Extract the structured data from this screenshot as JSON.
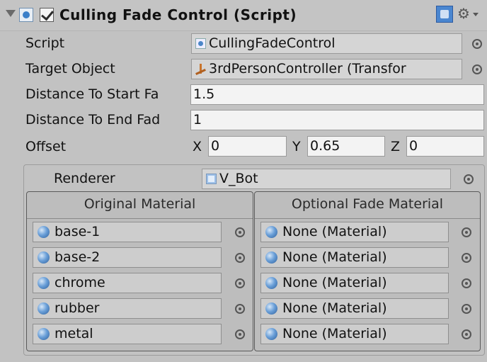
{
  "component": {
    "title": "Culling Fade Control (Script)",
    "enabled": true
  },
  "fields": {
    "script_label": "Script",
    "script_value": "CullingFadeControl",
    "target_label": "Target Object",
    "target_value": "3rdPersonController (Transfor",
    "start_label": "Distance To Start Fa",
    "start_value": "1.5",
    "end_label": "Distance To End Fad",
    "end_value": "1",
    "offset_label": "Offset",
    "offset_x_label": "X",
    "offset_x": "0",
    "offset_y_label": "Y",
    "offset_y": "0.65",
    "offset_z_label": "Z",
    "offset_z": "0"
  },
  "renderer": {
    "label": "Renderer",
    "value": "V_Bot",
    "original_header": "Original Material",
    "optional_header": "Optional Fade Material",
    "original_materials": [
      "base-1",
      "base-2",
      "chrome",
      "rubber",
      "metal"
    ],
    "fade_materials": [
      "None (Material)",
      "None (Material)",
      "None (Material)",
      "None (Material)",
      "None (Material)"
    ]
  },
  "icons": {
    "foldout": "triangle-down-icon",
    "script": "script-icon",
    "help": "help-book-icon",
    "gear": "gear-icon",
    "picker": "object-picker-icon",
    "material": "material-sphere-icon"
  }
}
